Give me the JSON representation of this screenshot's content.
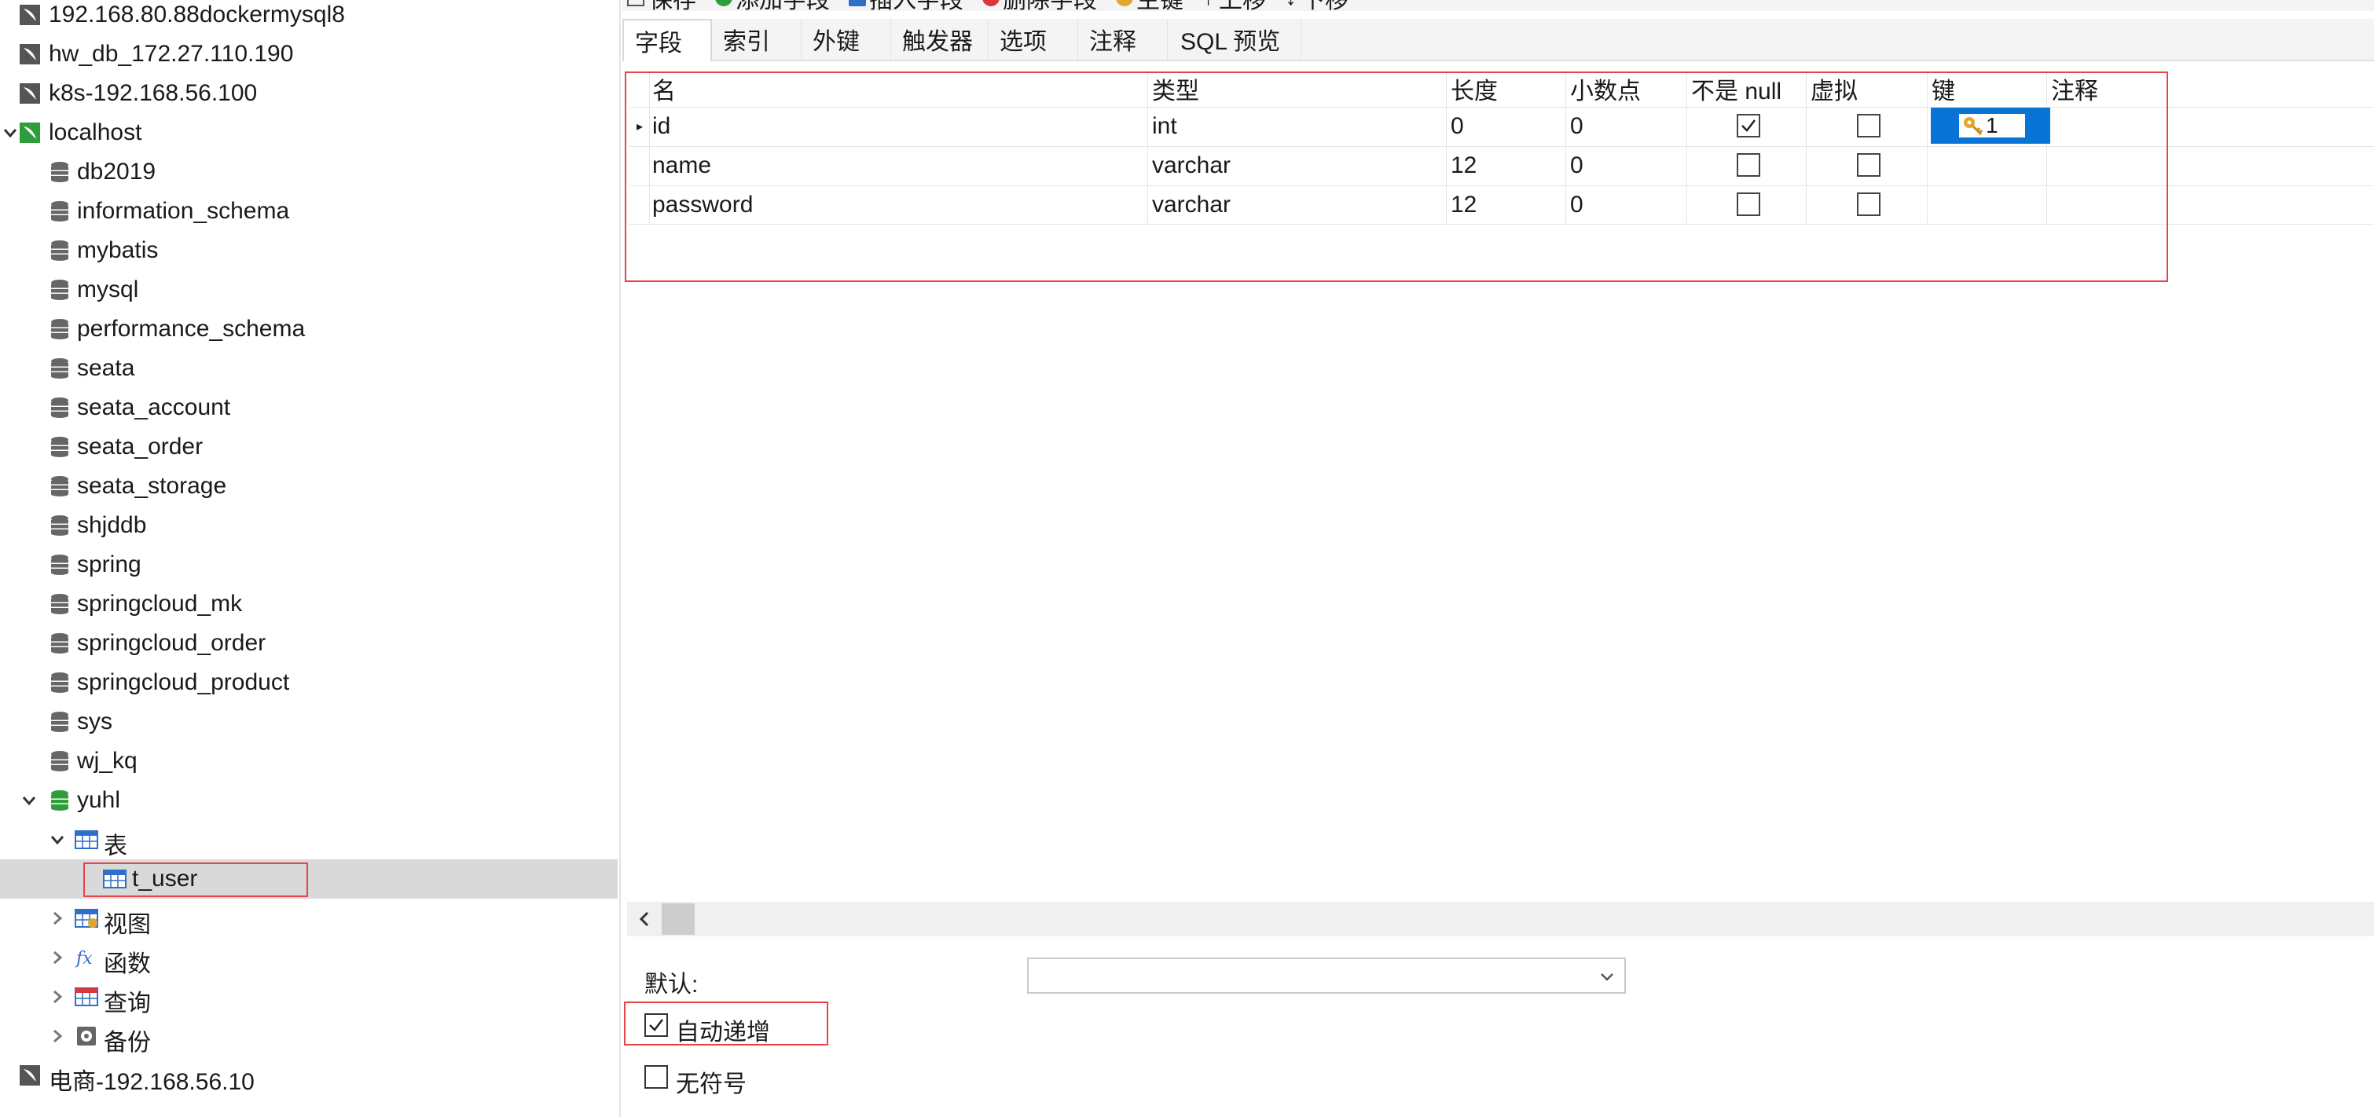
{
  "sidebar": {
    "items": [
      {
        "label": "192.168.80.88dockermysql8",
        "type": "connection"
      },
      {
        "label": "hw_db_172.27.110.190",
        "type": "connection"
      },
      {
        "label": "k8s-192.168.56.100",
        "type": "connection"
      },
      {
        "label": "localhost",
        "type": "connection-open"
      },
      {
        "label": "db2019",
        "type": "database"
      },
      {
        "label": "information_schema",
        "type": "database"
      },
      {
        "label": "mybatis",
        "type": "database"
      },
      {
        "label": "mysql",
        "type": "database"
      },
      {
        "label": "performance_schema",
        "type": "database"
      },
      {
        "label": "seata",
        "type": "database"
      },
      {
        "label": "seata_account",
        "type": "database"
      },
      {
        "label": "seata_order",
        "type": "database"
      },
      {
        "label": "seata_storage",
        "type": "database"
      },
      {
        "label": "shjddb",
        "type": "database"
      },
      {
        "label": "spring",
        "type": "database"
      },
      {
        "label": "springcloud_mk",
        "type": "database"
      },
      {
        "label": "springcloud_order",
        "type": "database"
      },
      {
        "label": "springcloud_product",
        "type": "database"
      },
      {
        "label": "sys",
        "type": "database"
      },
      {
        "label": "wj_kq",
        "type": "database"
      },
      {
        "label": "yuhl",
        "type": "database-open"
      },
      {
        "label": "表",
        "type": "tables"
      },
      {
        "label": "t_user",
        "type": "table"
      },
      {
        "label": "视图",
        "type": "views"
      },
      {
        "label": "函数",
        "type": "functions"
      },
      {
        "label": "查询",
        "type": "queries"
      },
      {
        "label": "备份",
        "type": "backups"
      },
      {
        "label": "电商-192.168.56.10",
        "type": "connection"
      }
    ]
  },
  "toolbar": {
    "items": [
      "保存",
      "添加字段",
      "插入字段",
      "删除字段",
      "主键",
      "上移",
      "下移"
    ]
  },
  "tabs": [
    "字段",
    "索引",
    "外键",
    "触发器",
    "选项",
    "注释",
    "SQL 预览"
  ],
  "grid": {
    "columns": [
      "名",
      "类型",
      "长度",
      "小数点",
      "不是 null",
      "虚拟",
      "键",
      "注释"
    ],
    "rows": [
      {
        "name": "id",
        "type": "int",
        "length": "0",
        "decimals": "0",
        "not_null": true,
        "virtual": false,
        "key": "1",
        "comment": ""
      },
      {
        "name": "name",
        "type": "varchar",
        "length": "12",
        "decimals": "0",
        "not_null": false,
        "virtual": false,
        "key": "",
        "comment": ""
      },
      {
        "name": "password",
        "type": "varchar",
        "length": "12",
        "decimals": "0",
        "not_null": false,
        "virtual": false,
        "key": "",
        "comment": ""
      }
    ]
  },
  "properties": {
    "default_label": "默认:",
    "default_value": "",
    "auto_increment_label": "自动递增",
    "auto_increment": true,
    "unsigned_label": "无符号",
    "unsigned": false
  },
  "colors": {
    "highlight_outline": "#e8424a",
    "key_cell": "#0a74d6",
    "db_icon": "#666666",
    "open_db_icon": "#2e9e3a",
    "selected_row": "#d9d9d9"
  }
}
